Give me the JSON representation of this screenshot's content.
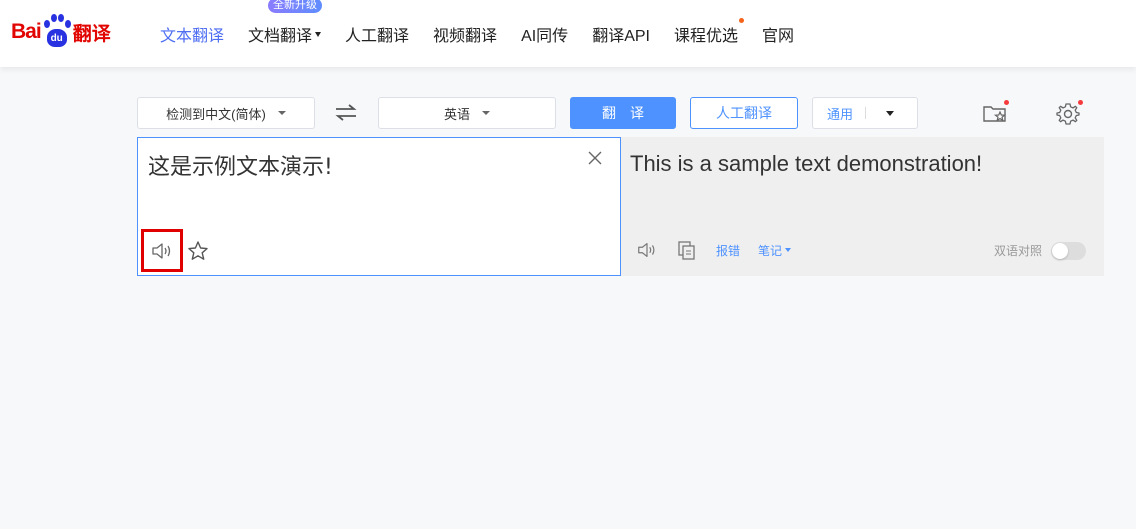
{
  "logo": {
    "text_bai": "Bai",
    "text_du": "du",
    "text_fanyi": "翻译"
  },
  "nav": {
    "items": [
      {
        "label": "文本翻译",
        "active": true
      },
      {
        "label": "文档翻译",
        "badge": "全新升级",
        "has_caret": true
      },
      {
        "label": "人工翻译"
      },
      {
        "label": "视频翻译"
      },
      {
        "label": "AI同传"
      },
      {
        "label": "翻译API"
      },
      {
        "label": "课程优选",
        "dot": true
      },
      {
        "label": "官网"
      }
    ]
  },
  "toolbar": {
    "source_lang": "检测到中文(简体)",
    "target_lang": "英语",
    "translate_label": "翻译",
    "human_translate_label": "人工翻译",
    "domain_label": "通用"
  },
  "source": {
    "text": "这是示例文本演示!"
  },
  "target": {
    "text": "This is a sample text demonstration!",
    "report_label": "报错",
    "notes_label": "笔记",
    "bilingual_label": "双语对照",
    "bilingual_on": false
  },
  "colors": {
    "accent": "#4e92ff",
    "nav_active": "#4e6ef2",
    "logo_red": "#e10602",
    "logo_blue": "#2932e1",
    "highlight_box": "#e00000"
  }
}
